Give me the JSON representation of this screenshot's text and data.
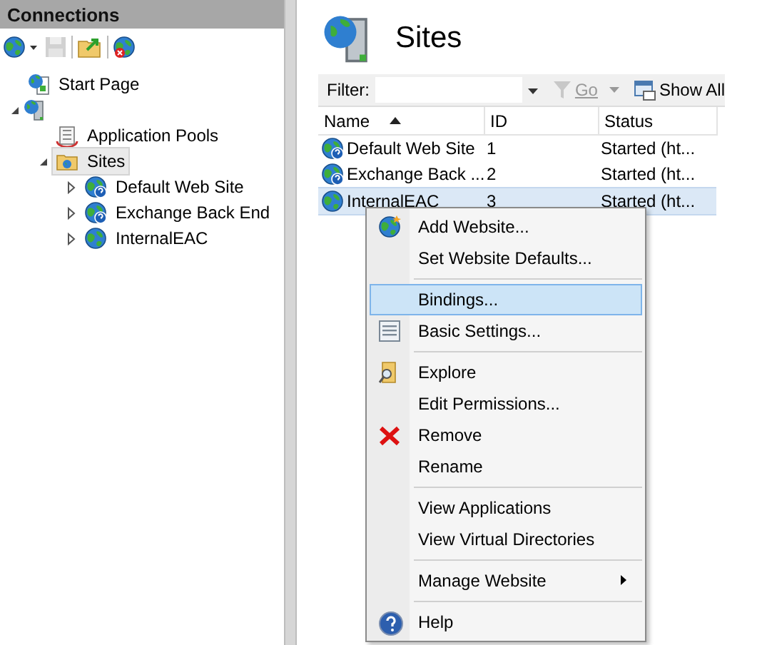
{
  "connections": {
    "title": "Connections",
    "toolbar": [
      {
        "kind": "connect",
        "disabled": false
      },
      {
        "kind": "save",
        "disabled": true
      },
      {
        "kind": "up",
        "disabled": false
      },
      {
        "kind": "disconnect",
        "disabled": false
      }
    ],
    "tree": [
      {
        "kind": "start",
        "label": "Start Page",
        "selected": false
      },
      {
        "kind": "server",
        "expanded": true,
        "selected": false,
        "children": [
          {
            "kind": "pools",
            "label": "Application Pools",
            "selected": false
          },
          {
            "kind": "sites",
            "label": "Sites",
            "expanded": true,
            "selected": true,
            "children": [
              {
                "kind": "site-question",
                "label": "Default Web Site",
                "expanded": false,
                "selected": false
              },
              {
                "kind": "site-question",
                "label": "Exchange Back End",
                "expanded": false,
                "selected": false
              },
              {
                "kind": "site",
                "label": "InternalEAC",
                "expanded": false,
                "selected": false
              }
            ]
          }
        ]
      }
    ]
  },
  "page": {
    "title": "Sites",
    "filter": {
      "label": "Filter:",
      "go": "Go",
      "show_all": "Show All"
    },
    "table": {
      "columns": [
        {
          "label": "Name",
          "sorted": true
        },
        {
          "label": "ID",
          "sorted": false
        },
        {
          "label": "Status",
          "sorted": false
        }
      ],
      "rows": [
        {
          "kind": "site-question",
          "name": "Default Web Site",
          "id": "1",
          "status": "Started (ht...",
          "selected": false
        },
        {
          "kind": "site-question",
          "name": "Exchange Back ...",
          "id": "2",
          "status": "Started (ht...",
          "selected": false
        },
        {
          "kind": "site",
          "name": "InternalEAC",
          "id": "3",
          "status": "Started (ht...",
          "selected": true
        }
      ]
    }
  },
  "context_menu": [
    {
      "kind": "add",
      "label": "Add Website...",
      "selected": false
    },
    {
      "kind": "plain",
      "label": "Set Website Defaults...",
      "selected": false
    },
    {
      "kind": "separator"
    },
    {
      "kind": "plain",
      "label": "Bindings...",
      "selected": true
    },
    {
      "kind": "settings",
      "label": "Basic Settings...",
      "selected": false
    },
    {
      "kind": "separator"
    },
    {
      "kind": "explore",
      "label": "Explore",
      "selected": false
    },
    {
      "kind": "plain",
      "label": "Edit Permissions...",
      "selected": false
    },
    {
      "kind": "remove",
      "label": "Remove",
      "selected": false
    },
    {
      "kind": "plain",
      "label": "Rename",
      "selected": false
    },
    {
      "kind": "separator"
    },
    {
      "kind": "plain",
      "label": "View Applications",
      "selected": false
    },
    {
      "kind": "plain",
      "label": "View Virtual Directories",
      "selected": false
    },
    {
      "kind": "separator"
    },
    {
      "kind": "submenu",
      "label": "Manage Website",
      "selected": false
    },
    {
      "kind": "separator"
    },
    {
      "kind": "help",
      "label": "Help",
      "selected": false
    }
  ]
}
